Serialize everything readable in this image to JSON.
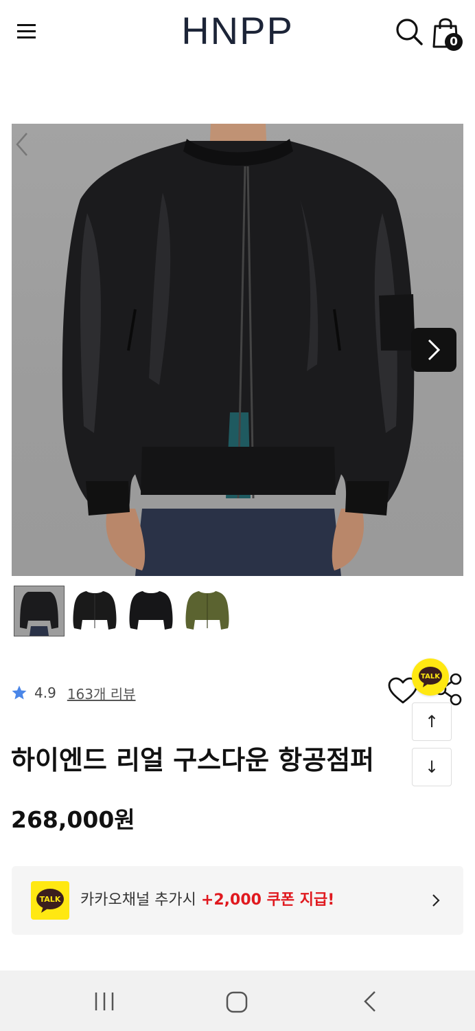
{
  "header": {
    "logo": "HNPP",
    "cart_count": "0",
    "icons": [
      "menu-icon",
      "search-icon",
      "shopping-bag-icon"
    ]
  },
  "gallery": {
    "thumbnails": [
      "thumb-black-model",
      "thumb-black-front",
      "thumb-black-back",
      "thumb-khaki-front"
    ],
    "active_index": 0,
    "colors": {
      "black": "#1a1a1a",
      "khaki": "#5b6330"
    }
  },
  "product": {
    "rating": "4.9",
    "review_link": "163개 리뷰",
    "title": "하이엔드 리얼 구스다운 항공점퍼",
    "price": "268,000원"
  },
  "floating": {
    "kakao_label": "TALK",
    "scroll_up": "↑",
    "scroll_down": "↓"
  },
  "coupon": {
    "logo_label": "TALK",
    "text": "카카오채널 추가시 ",
    "highlight": "+2,000 쿠폰 지급!"
  },
  "theme": {
    "kakao_yellow": "#ffe812",
    "highlight_red": "#e0191f",
    "star_blue": "#4a86e8"
  }
}
